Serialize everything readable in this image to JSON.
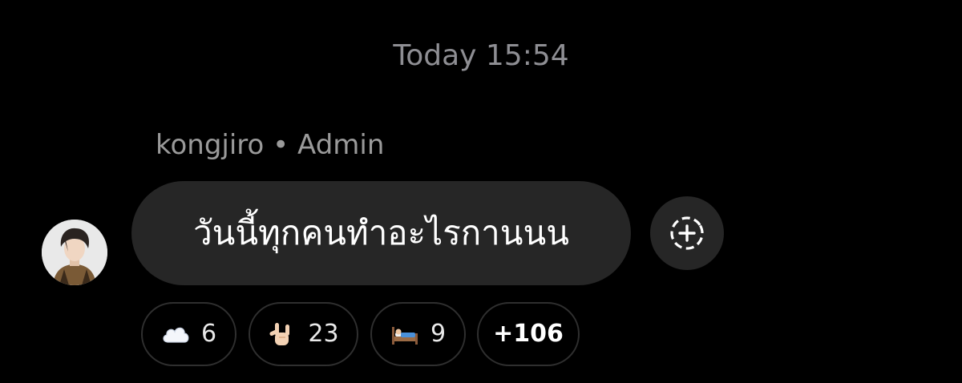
{
  "chat": {
    "timestamp": "Today 15:54"
  },
  "message": {
    "sender": "kongjiro",
    "separator": "•",
    "role": "Admin",
    "text": "วันนี้ทุกคนทำอะไรกานนน",
    "avatar_icon": "user-avatar-photo",
    "add_reaction_icon": "add-reaction-icon"
  },
  "reactions": [
    {
      "emoji": "☁️",
      "icon": "cloud-emoji-icon",
      "count": "6"
    },
    {
      "emoji": "🤟🏻",
      "icon": "love-you-gesture-emoji-icon",
      "count": "23"
    },
    {
      "emoji": "🛌",
      "icon": "person-in-bed-emoji-icon",
      "count": "9"
    }
  ],
  "more_reactions_label": "+106",
  "colors": {
    "background": "#000000",
    "bubble": "#262626",
    "timestamp_text": "#8e8e93",
    "sender_text": "#9a9a9a",
    "chip_border": "#2f2f2f"
  }
}
